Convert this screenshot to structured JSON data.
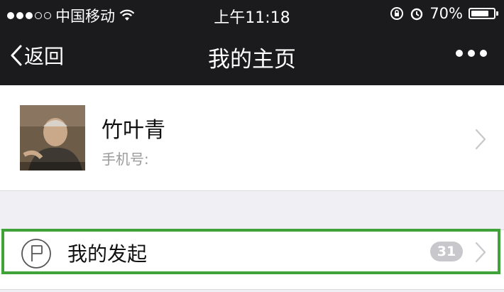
{
  "status_bar": {
    "carrier": "中国移动",
    "time": "上午11:18",
    "battery_percent": "70%",
    "battery_level": 0.7,
    "icons": [
      "signal-dots-icon",
      "wifi-icon",
      "rotation-lock-icon",
      "alarm-icon",
      "battery-icon"
    ]
  },
  "nav": {
    "back_label": "返回",
    "title": "我的主页",
    "more_icon": "more-dots-icon"
  },
  "profile": {
    "name": "竹叶青",
    "phone_label": "手机号:"
  },
  "menu": {
    "my_launch_label": "我的发起",
    "my_launch_count": "31",
    "icon": "flag-icon"
  },
  "colors": {
    "header_bg": "#1b1b1d",
    "page_bg": "#efeff4",
    "highlight": "#3fa33a",
    "badge_bg": "#c7c7cc"
  }
}
